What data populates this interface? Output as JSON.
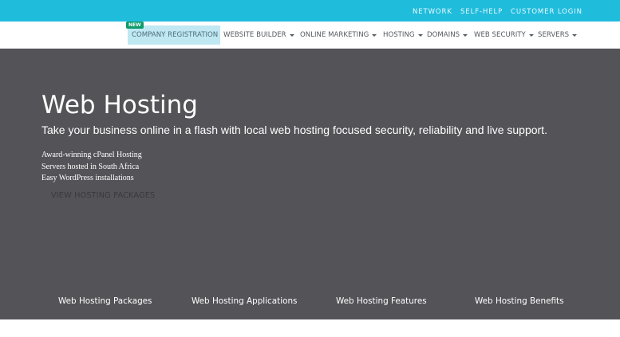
{
  "topbar": {
    "links": [
      "NETWORK",
      "SELF-HELP",
      "CUSTOMER LOGIN"
    ]
  },
  "nav": {
    "badge": "NEW",
    "items": [
      {
        "label": "COMPANY REGISTRATION",
        "dropdown": false
      },
      {
        "label": "WEBSITE BUILDER",
        "dropdown": true
      },
      {
        "label": "ONLINE MARKETING",
        "dropdown": true
      },
      {
        "label": "HOSTING",
        "dropdown": true
      },
      {
        "label": "DOMAINS",
        "dropdown": true
      },
      {
        "label": "WEB SECURITY",
        "dropdown": true
      },
      {
        "label": "SERVERS",
        "dropdown": true
      }
    ]
  },
  "hero": {
    "title": "Web Hosting",
    "subtitle": "Take your business online in a flash with local web hosting focused security, reliability and live support.",
    "features": [
      "Award-winning cPanel Hosting",
      "Servers hosted in South Africa",
      "Easy WordPress installations"
    ],
    "cta": "VIEW HOSTING PACKAGES",
    "tabs": [
      "Web Hosting Packages",
      "Web Hosting Applications",
      "Web Hosting Features",
      "Web Hosting Benefits"
    ]
  },
  "colors": {
    "topbar": "#1fbcdc",
    "hero_background": "#545358",
    "highlight": "#bfe8f2",
    "badge": "#0d9b6a"
  }
}
